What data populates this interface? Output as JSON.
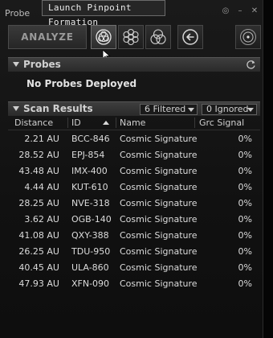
{
  "window": {
    "title": "Probe"
  },
  "tooltip": {
    "text": "Launch Pinpoint Formation"
  },
  "toolbar": {
    "analyze_label": "ANALYZE",
    "buttons": [
      "pinpoint-formation-icon",
      "spread-formation-icon",
      "triple-circle-icon",
      "back-arrow-icon",
      "map-view-icon"
    ]
  },
  "probes": {
    "header": "Probes",
    "empty_text": "No Probes Deployed"
  },
  "scan": {
    "header": "Scan Results",
    "filter_label": "6 Filtered",
    "ignored_label": "0 Ignored",
    "columns": {
      "distance": "Distance",
      "id": "ID",
      "name": "Name",
      "signal": "Grc Signal"
    },
    "rows": [
      {
        "distance": "2.21 AU",
        "id": "BCC-846",
        "name": "Cosmic Signature",
        "signal": "0%"
      },
      {
        "distance": "28.52 AU",
        "id": "EPJ-854",
        "name": "Cosmic Signature",
        "signal": "0%"
      },
      {
        "distance": "43.48 AU",
        "id": "IMX-400",
        "name": "Cosmic Signature",
        "signal": "0%"
      },
      {
        "distance": "4.44 AU",
        "id": "KUT-610",
        "name": "Cosmic Signature",
        "signal": "0%"
      },
      {
        "distance": "28.25 AU",
        "id": "NVE-318",
        "name": "Cosmic Signature",
        "signal": "0%"
      },
      {
        "distance": "3.62 AU",
        "id": "OGB-140",
        "name": "Cosmic Signature",
        "signal": "0%"
      },
      {
        "distance": "41.08 AU",
        "id": "QXY-388",
        "name": "Cosmic Signature",
        "signal": "0%"
      },
      {
        "distance": "26.25 AU",
        "id": "TDU-950",
        "name": "Cosmic Signature",
        "signal": "0%"
      },
      {
        "distance": "40.45 AU",
        "id": "ULA-860",
        "name": "Cosmic Signature",
        "signal": "0%"
      },
      {
        "distance": "47.93 AU",
        "id": "XFN-090",
        "name": "Cosmic Signature",
        "signal": "0%"
      }
    ]
  }
}
